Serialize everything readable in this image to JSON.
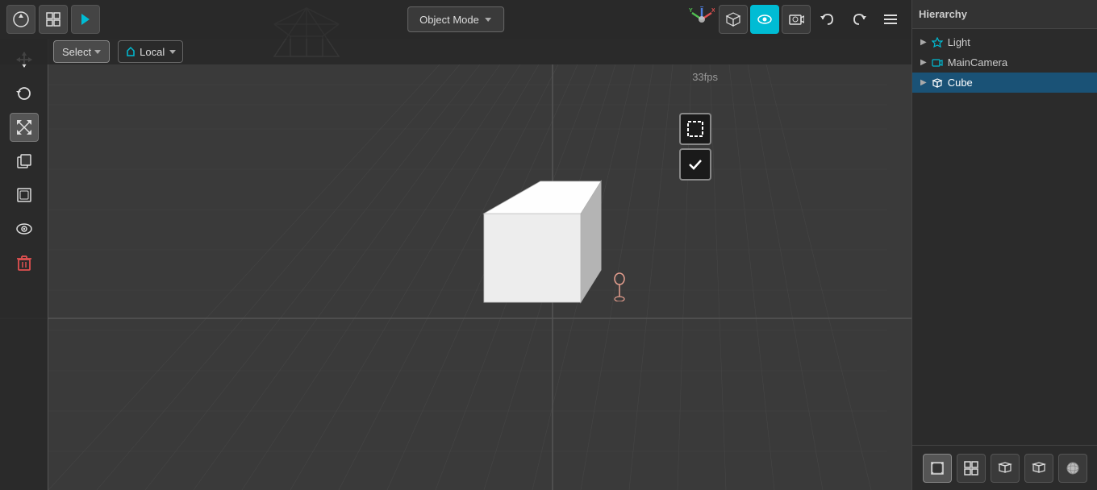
{
  "toolbar": {
    "object_mode_label": "Object Mode",
    "select_label": "Select",
    "local_label": "Local",
    "hierarchy_label": "Hierarchy"
  },
  "viewport": {
    "fps": "33fps"
  },
  "hierarchy": {
    "items": [
      {
        "id": "light",
        "label": "Light",
        "icon": "▶",
        "active": false
      },
      {
        "id": "maincamera",
        "label": "MainCamera",
        "icon": "▶",
        "active": false
      },
      {
        "id": "cube",
        "label": "Cube",
        "icon": "▶",
        "active": true
      }
    ]
  },
  "icons": {
    "blender_logo": "⬡",
    "layout_icon": "⊞",
    "play_icon": "▶",
    "refresh_icon": "↺",
    "move_icon": "✛",
    "copy_icon": "⧉",
    "layer_icon": "▣",
    "eye_icon": "👁",
    "trash_icon": "🗑",
    "undo_icon": "↩",
    "redo_icon": "↪",
    "menu_icon": "☰",
    "persp_icon": "⬡",
    "view_icon": "👁",
    "camera_icon": "📷",
    "axis_x": "X",
    "axis_y": "Y",
    "axis_z": "Z",
    "select_rect_icon": "⬚",
    "checkmark_icon": "✓",
    "bottom_icon1": "◼",
    "bottom_icon2": "⊞",
    "bottom_icon3": "⬡",
    "bottom_icon4": "⬡",
    "bottom_icon5": "●"
  },
  "colors": {
    "bg_dark": "#2d2d2d",
    "viewport_bg": "#3a3a3a",
    "accent_cyan": "#00bcd4",
    "active_blue": "#1a5276",
    "danger_red": "#e05050",
    "grid_line": "#454545",
    "light_arrow": "#00bcd4"
  }
}
